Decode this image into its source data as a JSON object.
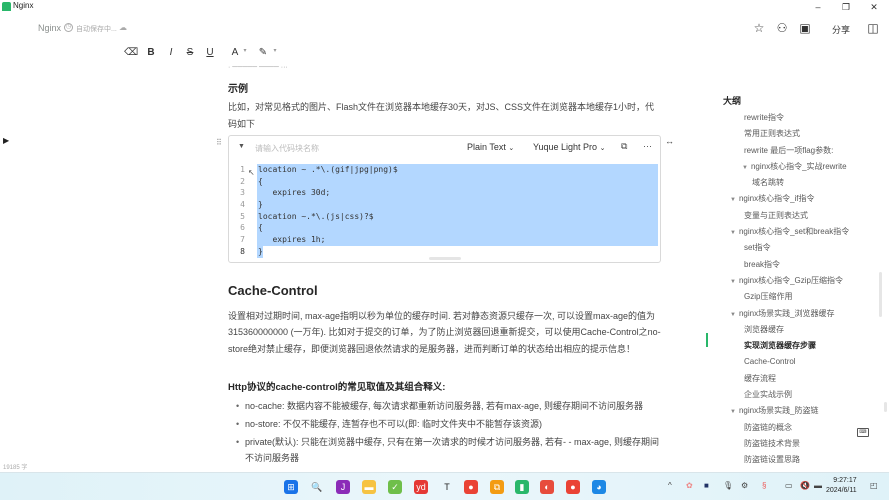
{
  "window": {
    "app_title": "Nginx",
    "minimize": "–",
    "maximize": "❐",
    "close": "✕"
  },
  "header": {
    "doc_name": "Nginx",
    "saving_status": "自动保存中...",
    "share_label": "分享",
    "icons": [
      "star-icon",
      "add-collaborator-icon",
      "present-icon",
      "sidebar-toggle-icon"
    ]
  },
  "format_bar": {
    "clear": "⌫",
    "bold": "B",
    "italic": "I",
    "strike": "S",
    "underline": "U",
    "font_color": "A",
    "highlight": "✎",
    "dropdown": "▾"
  },
  "content": {
    "example_heading": "示例",
    "example_paragraph": "比如，对常见格式的图片、Flash文件在浏览器本地缓存30天，对JS、CSS文件在浏览器本地缓存1小时，代码如下",
    "code_block": {
      "name_placeholder": "请输入代码块名称",
      "language": "Plain Text",
      "theme": "Yuque Light Pro",
      "lines": [
        "location ~ .*\\.(gif|jpg|png)$",
        "{",
        "   expires 30d;",
        "}",
        "location ~.*\\.(js|css)?$",
        "{",
        "   expires 1h;",
        "}"
      ]
    },
    "cache_heading": "Cache-Control",
    "cache_paragraph": "设置相对过期时间, max-age指明以秒为单位的缓存时间. 若对静态资源只缓存一次, 可以设置max-age的值为315360000000 (一万年). 比如对于提交的订单，为了防止浏览器回退重新提交，可以使用Cache-Control之no-store绝对禁止缓存，即便浏览器回退依然请求的是服务器，进而判断订单的状态给出相应的提示信息！",
    "http_heading": "Http协议的cache-control的常见取值及其组合释义:",
    "bullets": [
      "no-cache: 数据内容不能被缓存, 每次请求都重新访问服务器, 若有max-age, 则缓存期间不访问服务器",
      "no-store: 不仅不能缓存, 连暂存也不可以(即: 临时文件夹中不能暂存该资源)",
      "private(默认): 只能在浏览器中缓存, 只有在第一次请求的时候才访问服务器, 若有- - max-age, 则缓存期间不访问服务器"
    ]
  },
  "status": {
    "word_count": "19185 字"
  },
  "outline": {
    "title": "大纲",
    "items": [
      {
        "label": "rewrite指令",
        "level": 3,
        "collapsible": false
      },
      {
        "label": "常用正则表达式",
        "level": 3,
        "collapsible": false
      },
      {
        "label": "rewrite 最后一项flag参数:",
        "level": 3,
        "collapsible": false
      },
      {
        "label": "nginx核心指令_实战rewrite",
        "level": 2,
        "collapsible": true
      },
      {
        "label": "域名跳转",
        "level": 4,
        "collapsible": false
      },
      {
        "label": "nginx核心指令_if指令",
        "level": 1,
        "collapsible": true
      },
      {
        "label": "变量与正则表达式",
        "level": 3,
        "collapsible": false
      },
      {
        "label": "nginx核心指令_set和break指令",
        "level": 1,
        "collapsible": true
      },
      {
        "label": "set指令",
        "level": 3,
        "collapsible": false
      },
      {
        "label": "break指令",
        "level": 3,
        "collapsible": false
      },
      {
        "label": "nginx核心指令_Gzip压缩指令",
        "level": 1,
        "collapsible": true
      },
      {
        "label": "Gzip压缩作用",
        "level": 3,
        "collapsible": false
      },
      {
        "label": "nginx场景实践_浏览器缓存",
        "level": 1,
        "collapsible": true
      },
      {
        "label": "浏览器缓存",
        "level": 3,
        "collapsible": false
      },
      {
        "label": "实现浏览器缓存步骤",
        "level": 3,
        "collapsible": false,
        "active": true
      },
      {
        "label": "Cache-Control",
        "level": 3,
        "collapsible": false
      },
      {
        "label": "缓存流程",
        "level": 3,
        "collapsible": false
      },
      {
        "label": "企业实战示例",
        "level": 3,
        "collapsible": false
      },
      {
        "label": "nginx场景实践_防盗链",
        "level": 1,
        "collapsible": true
      },
      {
        "label": "防盗链的概念",
        "level": 3,
        "collapsible": false
      },
      {
        "label": "防盗链技术背景",
        "level": 3,
        "collapsible": false
      },
      {
        "label": "防盗链设置思路",
        "level": 3,
        "collapsible": false
      }
    ]
  },
  "taskbar": {
    "apps": [
      {
        "name": "windows-start",
        "color": "#1a73e8",
        "glyph": "⊞"
      },
      {
        "name": "search",
        "color": "transparent",
        "glyph": "🔍"
      },
      {
        "name": "jetbrains",
        "color": "#8b2cb8",
        "glyph": "J"
      },
      {
        "name": "file-explorer",
        "color": "#f6c342",
        "glyph": "▬"
      },
      {
        "name": "notepad-plus",
        "color": "#6fbf4a",
        "glyph": "✓"
      },
      {
        "name": "youdao",
        "color": "#e53935",
        "glyph": "yd"
      },
      {
        "name": "typora",
        "color": "transparent",
        "glyph": "T"
      },
      {
        "name": "chrome",
        "color": "#ea4335",
        "glyph": "●"
      },
      {
        "name": "vmware",
        "color": "#f39c12",
        "glyph": "⧉"
      },
      {
        "name": "yuque",
        "color": "#29b76a",
        "glyph": "▮"
      },
      {
        "name": "snail",
        "color": "#e74c3c",
        "glyph": "◐"
      },
      {
        "name": "chrome-profile",
        "color": "#ea4335",
        "glyph": "●"
      },
      {
        "name": "edge",
        "color": "#1e88e5",
        "glyph": "◕"
      }
    ],
    "tray": {
      "chevron": "^",
      "time": "9:27:17",
      "date": "2024/6/11"
    }
  }
}
